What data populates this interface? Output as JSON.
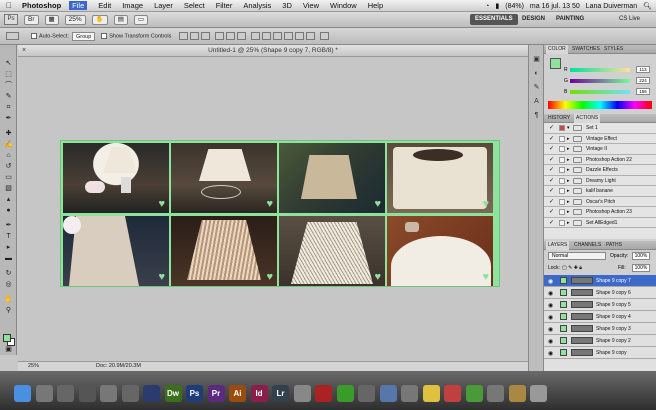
{
  "menubar": {
    "apple": "",
    "app": "Photoshop",
    "items": [
      "File",
      "Edit",
      "Image",
      "Layer",
      "Select",
      "Filter",
      "Analysis",
      "3D",
      "View",
      "Window",
      "Help"
    ],
    "status": {
      "battery": "(84%)",
      "datetime": "ma 16 jul.  13 50",
      "user": "Lana Duiverman"
    }
  },
  "appbar": {
    "logo": "Ps",
    "zoom": "25%",
    "workspaces": {
      "essentials": "ESSENTIALS",
      "design": "DESIGN",
      "painting": "PAINTING"
    },
    "cslive": "CS Live"
  },
  "options": {
    "auto_select": "Auto-Select:",
    "group": "Group",
    "show_transform": "Show Transform Controls"
  },
  "document": {
    "title": "Untitled-1 @ 25% (Shape 9 copy 7, RGB/8) *",
    "zoom": "25%",
    "doc_info": "Doc: 20.9M/20.3M"
  },
  "color_panel": {
    "tabs": [
      "COLOR",
      "SWATCHES",
      "STYLES"
    ],
    "channels": [
      {
        "label": "R",
        "value": "113"
      },
      {
        "label": "G",
        "value": "224"
      },
      {
        "label": "B",
        "value": "156"
      }
    ],
    "foreground": "#8ee29b"
  },
  "history_panel": {
    "tabs": [
      "HISTORY",
      "ACTIONS"
    ],
    "items": [
      "Set 1",
      "Vintage Effect",
      "Vintage II",
      "Photoshop Action 22",
      "Dazzle Effects",
      "Dreamy Light",
      "kalif banane",
      "Oscar's Pitch",
      "Photoshop Action 23",
      "Set AllEdged1"
    ]
  },
  "layers_panel": {
    "tabs": [
      "LAYERS",
      "CHANNELS",
      "PATHS"
    ],
    "blend_mode": "Normal",
    "opacity_label": "Opacity:",
    "opacity": "100%",
    "lock_label": "Lock:",
    "fill_label": "Fill:",
    "fill": "100%",
    "layers": [
      "Shape 9 copy 7",
      "Shape 9 copy 6",
      "Shape 9 copy 5",
      "Shape 9 copy 4",
      "Shape 9 copy 3",
      "Shape 9 copy 2",
      "Shape 9 copy"
    ]
  },
  "dock": {
    "apps": [
      {
        "icon": "finder-icon",
        "label": "",
        "color": "#4a8fe0"
      },
      {
        "icon": "photo-icon",
        "label": "",
        "color": "#777"
      },
      {
        "icon": "app-icon",
        "label": "",
        "color": "#666"
      },
      {
        "icon": "app-icon-2",
        "label": "",
        "color": "#555"
      },
      {
        "icon": "app-icon-3",
        "label": "",
        "color": "#777"
      },
      {
        "icon": "app-icon-4",
        "label": "",
        "color": "#666"
      },
      {
        "icon": "bridge-icon",
        "label": "",
        "color": "#2b3b6e"
      },
      {
        "icon": "dreamweaver-icon",
        "label": "Dw",
        "color": "#3c6f1d"
      },
      {
        "icon": "photoshop-icon",
        "label": "Ps",
        "color": "#1e3d78"
      },
      {
        "icon": "premiere-icon",
        "label": "Pr",
        "color": "#5b2a7d"
      },
      {
        "icon": "illustrator-icon",
        "label": "Ai",
        "color": "#9a4c0d"
      },
      {
        "icon": "indesign-icon",
        "label": "Id",
        "color": "#8a1f4d"
      },
      {
        "icon": "lightroom-icon",
        "label": "Lr",
        "color": "#33414f"
      },
      {
        "icon": "app-icon-5",
        "label": "",
        "color": "#888"
      },
      {
        "icon": "app-icon-6",
        "label": "",
        "color": "#aa2222"
      },
      {
        "icon": "utorrent-icon",
        "label": "",
        "color": "#3a9b2a"
      },
      {
        "icon": "app-icon-7",
        "label": "",
        "color": "#666"
      },
      {
        "icon": "app-icon-8",
        "label": "",
        "color": "#5577aa"
      },
      {
        "icon": "app-icon-9",
        "label": "",
        "color": "#777"
      },
      {
        "icon": "notes-icon",
        "label": "",
        "color": "#e0c040"
      },
      {
        "icon": "app-icon-10",
        "label": "",
        "color": "#c04040"
      },
      {
        "icon": "chrome-icon",
        "label": "",
        "color": "#4a9a3a"
      },
      {
        "icon": "app-icon-11",
        "label": "",
        "color": "#777"
      },
      {
        "icon": "app-icon-12",
        "label": "",
        "color": "#aa8844"
      },
      {
        "icon": "trash-icon",
        "label": "",
        "color": "#999"
      }
    ]
  },
  "colors": {
    "accent": "#8ee29b",
    "selection": "#3d69c8"
  }
}
